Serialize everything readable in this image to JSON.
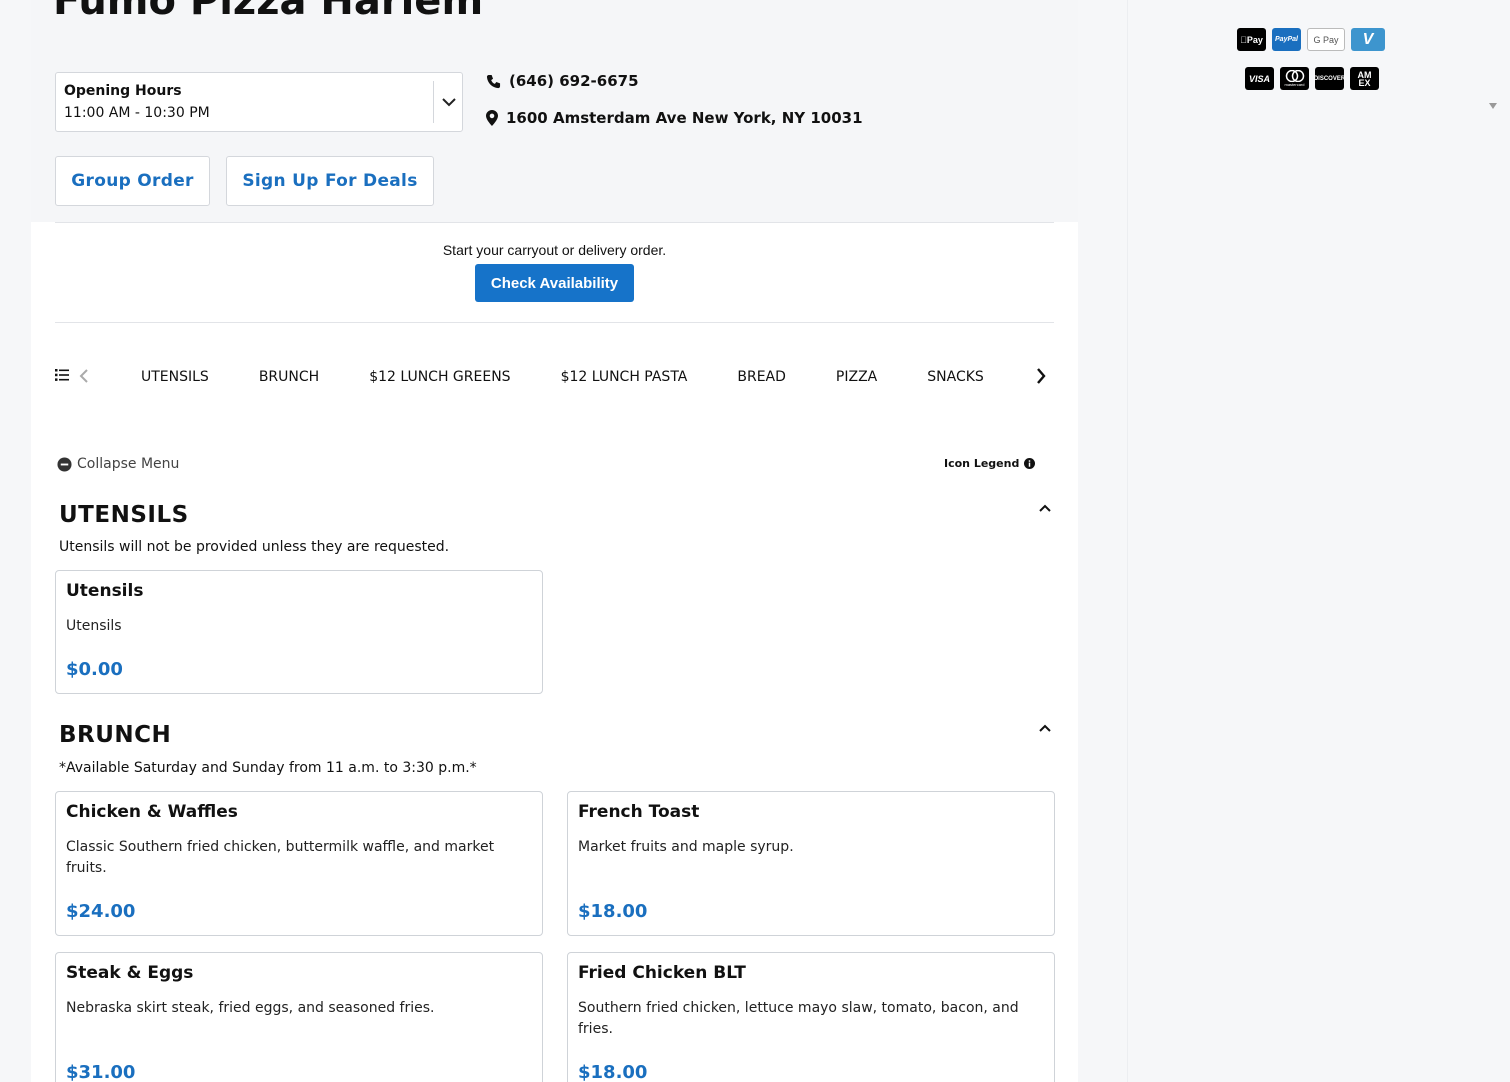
{
  "header": {
    "title": "Fumo Pizza Harlem",
    "hours_label": "Opening Hours",
    "hours_value": "11:00 AM - 10:30 PM",
    "phone": "(646) 692-6675",
    "address": "1600 Amsterdam Ave New York, NY 10031",
    "group_order_label": "Group Order",
    "deals_label": "Sign Up For Deals"
  },
  "order": {
    "prompt": "Start your carryout or delivery order.",
    "check_label": "Check Availability"
  },
  "categories": [
    "UTENSILS",
    "BRUNCH",
    "$12 LUNCH GREENS",
    "$12 LUNCH PASTA",
    "BREAD",
    "PIZZA",
    "SNACKS"
  ],
  "menu_controls": {
    "collapse_label": "Collapse Menu",
    "legend_label": "Icon Legend"
  },
  "sections": [
    {
      "title": "UTENSILS",
      "description": "Utensils will not be provided unless they are requested.",
      "items": [
        {
          "name": "Utensils",
          "description": "Utensils",
          "price": "$0.00"
        }
      ]
    },
    {
      "title": "BRUNCH",
      "description": "*Available Saturday and Sunday from 11 a.m. to 3:30 p.m.*",
      "items": [
        {
          "name": "Chicken & Waffles",
          "description": "Classic Southern fried chicken, buttermilk waffle, and market fruits.",
          "price": "$24.00"
        },
        {
          "name": "French Toast",
          "description": "Market fruits and maple syrup.",
          "price": "$18.00"
        },
        {
          "name": "Steak & Eggs",
          "description": "Nebraska skirt steak, fried eggs, and seasoned fries.",
          "price": "$31.00"
        },
        {
          "name": "Fried Chicken BLT",
          "description": "Southern fried chicken, lettuce mayo slaw, tomato, bacon, and fries.",
          "price": "$18.00"
        }
      ]
    }
  ],
  "payments": {
    "row1": [
      "Pay",
      "PayPal",
      "G Pay",
      "V"
    ],
    "row2": [
      "VISA",
      "mastercard",
      "DISCOVER",
      "AM EX"
    ]
  },
  "colors": {
    "accent": "#1673c9",
    "link": "#1a6fbf"
  }
}
